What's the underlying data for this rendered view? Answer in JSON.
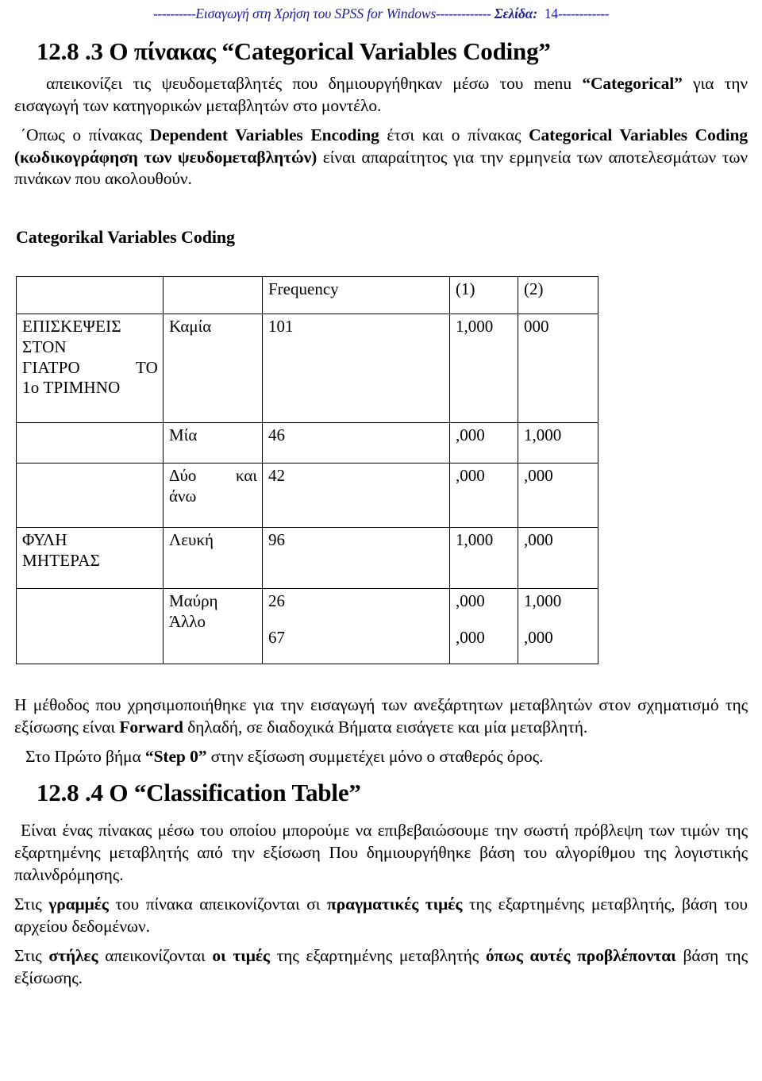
{
  "header": {
    "left_dashes": "----------",
    "title": "Εισαγωγή στη Χρήση του SPSS for Windows",
    "mid_dashes": "-------------",
    "page_label": "Σελίδα:",
    "page_number": "14",
    "right_dashes": "------------"
  },
  "headings": {
    "h1": "12.8 .3 Ο πίνακας “Categorical Variables Coding”",
    "h2": "12.8 .4 Ο “Classification Table”"
  },
  "paragraphs": {
    "p1_part1": "απεικονίζει τις ψευδομεταβλητές που δημιουργήθηκαν μέσω του menu ",
    "p1_bold": "“Categorical”",
    "p1_part2": " για την εισαγωγή των κατηγορικών μεταβλητών στο μοντέλο.",
    "p2_part1": "΄Οπως ο πίνακας ",
    "p2_bold1": "Dependent Variables Encoding",
    "p2_part2": " έτσι και ο πίνακας ",
    "p2_bold2": "Categorical Variables Coding (κωδικογράφηση των ψευδομεταβλητών)",
    "p2_part3": " είναι απαραίτητος για την ερμηνεία των αποτελεσμάτων των πινάκων που ακολουθούν.",
    "p3_part1": "Η μέθοδος που χρησιμοποιήθηκε για την εισαγωγή των ανεξάρτητων μεταβλητών στον σχηματισμό της εξίσωσης είναι ",
    "p3_bold": "Forward",
    "p3_part2": " δηλαδή, σε διαδοχικά Βήματα εισάγετε και μία μεταβλητή.",
    "p4_part1": "Στο Πρώτο βήμα ",
    "p4_bold": "“Step  0”",
    "p4_part2": " στην εξίσωση συμμετέχει μόνο ο σταθερός όρος.",
    "p5": "Είναι ένας πίνακας μέσω του οποίου μπορούμε να επιβεβαιώσουμε την σωστή πρόβλεψη των τιμών της εξαρτημένης μεταβλητής από την εξίσωση Που δημιουργήθηκε βάση του αλγορίθμου της λογιστικής παλινδρόμησης.",
    "p6_part1": "Στις ",
    "p6_bold1": "γραμμές",
    "p6_part2": " του πίνακα απεικονίζονται σι ",
    "p6_bold2": "πραγματικές τιμές",
    "p6_part3": " της εξαρτημένης μεταβλητής, βάση του αρχείου δεδομένων.",
    "p7_part1": "Στις ",
    "p7_bold1": "στήλες",
    "p7_part2": " απεικονίζονται ",
    "p7_bold2": "οι τιμές",
    "p7_part3": " της εξαρτημένης μεταβλητής ",
    "p7_bold3": "όπως αυτές προβλέπονται",
    "p7_part4": " βάση της εξίσωσης."
  },
  "table_caption": "Categorikal Variables Coding",
  "chart_data": {
    "type": "table",
    "title": "Categorikal Variables Coding",
    "columns": [
      "",
      "",
      "Frequency",
      "(1)",
      "(2)"
    ],
    "rows": [
      {
        "variable": "ΕΠΙΣΚΕΨΕΙΣ ΣΤΟΝ ΓΙΑΤΡΟ  ΤΟ 1ο ΤΡΙΜΗΝΟ",
        "category": "Καμία",
        "frequency": "101",
        "c1": "1,000",
        "c2": "000"
      },
      {
        "variable": "",
        "category": "Μία",
        "frequency": "46",
        "c1": ",000",
        "c2": "1,000"
      },
      {
        "variable": "",
        "category": "Δύο  και άνω",
        "category_line1": "Δύο",
        "category_line1b": "και",
        "category_line2": "άνω",
        "frequency": "42",
        "c1": ",000",
        "c2": ",000"
      },
      {
        "variable": "ΦΥΛΗ ΜΗΤΕΡΑΣ",
        "category": "Λευκή",
        "frequency": "96",
        "c1": "1,000",
        "c2": ",000"
      },
      {
        "variable": "",
        "category_line1": "Μαύρη",
        "category_line2": "Άλλο",
        "frequency_line1": "26",
        "frequency_line2": "67",
        "c1_line1": ",000",
        "c1_line2": ",000",
        "c2_line1": "1,000",
        "c2_line2": ",000"
      }
    ]
  },
  "table": {
    "col_headers": {
      "h1": "",
      "h2": "",
      "h3": "Frequency",
      "h4": "(1)",
      "h5": "(2)"
    },
    "r1": {
      "var_l1": "ΕΠΙΣΚΕΨΕΙΣ",
      "var_l2": "ΣΤΟΝ",
      "var_l3a": "ΓΙΑΤΡΟ",
      "var_l3b": "ΤΟ",
      "var_l4": "1ο ΤΡΙΜΗΝΟ",
      "cat": "Καμία",
      "freq": "101",
      "c1": "1,000",
      "c2": "000"
    },
    "r2": {
      "cat": "Μία",
      "freq": "46",
      "c1": ",000",
      "c2": "1,000"
    },
    "r3": {
      "cat_a": "Δύο",
      "cat_b": "και",
      "cat_c": "άνω",
      "freq": "42",
      "c1": ",000",
      "c2": ",000"
    },
    "r4": {
      "var_l1": "ΦΥΛΗ",
      "var_l2": "ΜΗΤΕΡΑΣ",
      "cat": "Λευκή",
      "freq": "96",
      "c1": "1,000",
      "c2": ",000"
    },
    "r5": {
      "cat_l1": "Μαύρη",
      "cat_l2": "Άλλο",
      "freq_l1": "26",
      "freq_l2": "67",
      "c1_l1": ",000",
      "c1_l2": ",000",
      "c2_l1": "1,000",
      "c2_l2": ",000"
    }
  }
}
